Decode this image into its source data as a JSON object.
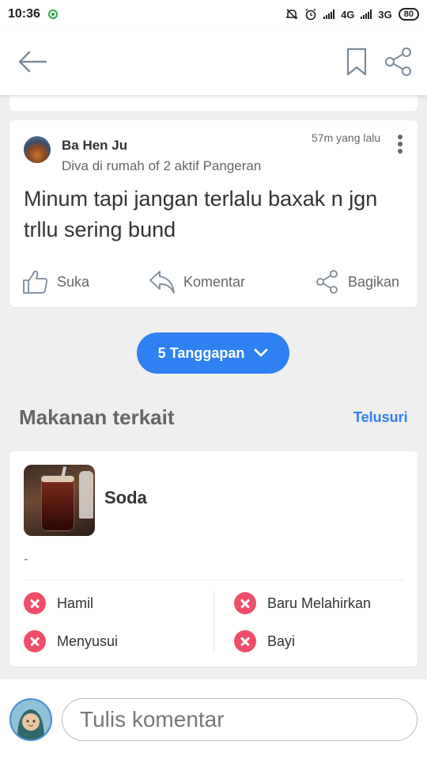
{
  "status_bar": {
    "time": "10:36",
    "network_1": "4G",
    "network_2": "3G",
    "battery": "80"
  },
  "app_bar": {
    "back_icon": "arrow-left-icon",
    "bookmark_icon": "bookmark-icon",
    "share_icon": "share-icon"
  },
  "comment": {
    "author": "Ba Hen Ju",
    "subtitle": "Diva di rumah of 2 aktif Pangeran",
    "time": "57m yang lalu",
    "text": "Minum tapi jangan terlalu baxak n jgn trllu sering bund",
    "actions": {
      "like": "Suka",
      "comment": "Komentar",
      "share": "Bagikan"
    }
  },
  "replies_button": {
    "label": "5 Tanggapan",
    "icon": "chevron-down-icon"
  },
  "related": {
    "title": "Makanan terkait",
    "browse": "Telusuri",
    "food": {
      "name": "Soda",
      "description": "-",
      "statuses": [
        {
          "label": "Hamil",
          "allowed": false
        },
        {
          "label": "Baru Melahirkan",
          "allowed": false
        },
        {
          "label": "Menyusui",
          "allowed": false
        },
        {
          "label": "Bayi",
          "allowed": false
        }
      ]
    }
  },
  "comment_box": {
    "placeholder": "Tulis komentar"
  },
  "colors": {
    "accent": "#2f80f0",
    "not_allowed": "#ef4d6a",
    "background": "#efefef"
  }
}
